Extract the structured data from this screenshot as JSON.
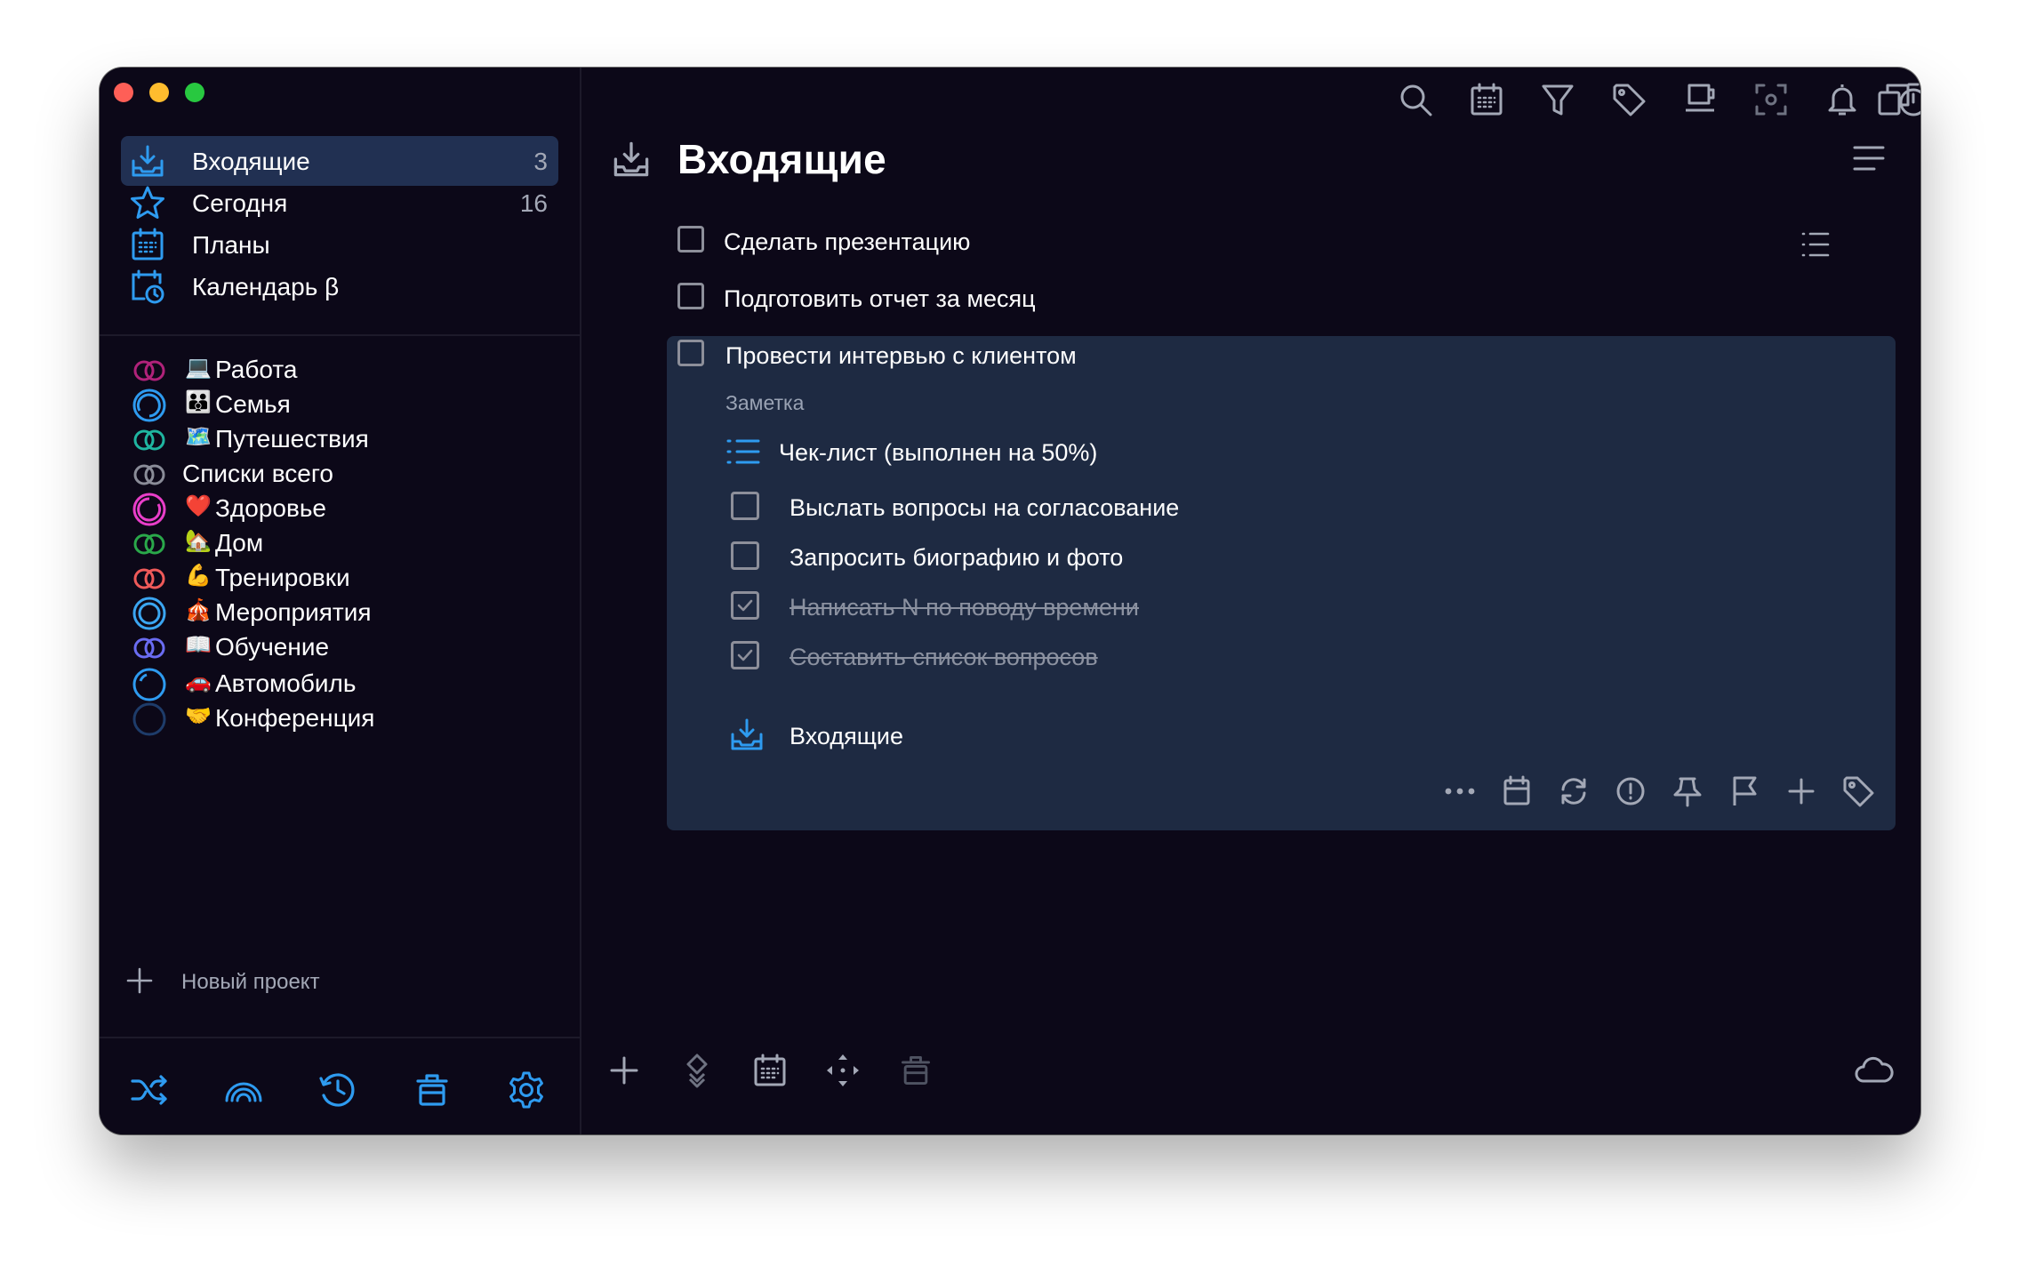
{
  "window": {
    "traffic_lights": [
      "#fe5f57",
      "#febc2e",
      "#28c840"
    ]
  },
  "colors": {
    "accent": "#2e9bf0",
    "sidebar_active": "#213052",
    "expanded_card": "#1e2a42",
    "background": "#0c0818",
    "muted_text": "#a3a8b6"
  },
  "sidebar": {
    "nav": [
      {
        "label": "Входящие",
        "count": "3",
        "icon": "inbox-icon",
        "active": true
      },
      {
        "label": "Сегодня",
        "count": "16",
        "icon": "star-icon"
      },
      {
        "label": "Планы",
        "count": "",
        "icon": "calendar-grid-icon"
      },
      {
        "label": "Календарь β",
        "count": "",
        "icon": "calendar-clock-icon"
      }
    ],
    "projects": [
      {
        "label": "Работа",
        "emoji": "💻",
        "ring": "double-ring",
        "color": "#b0227a"
      },
      {
        "label": "Семья",
        "emoji": "👪",
        "ring": "progress-ring",
        "color": "#2e9bf0"
      },
      {
        "label": "Путешествия",
        "emoji": "🗺️",
        "ring": "double-ring",
        "color": "#1fb5a0"
      },
      {
        "label": "Списки всего",
        "emoji": "",
        "ring": "double-ring",
        "color": "#8a8c98"
      },
      {
        "label": "Здоровье",
        "emoji": "❤️",
        "ring": "progress-ring",
        "color": "#e93ec9"
      },
      {
        "label": "Дом",
        "emoji": "🏡",
        "ring": "double-ring",
        "color": "#2aa84a"
      },
      {
        "label": "Тренировки",
        "emoji": "💪",
        "ring": "double-ring",
        "color": "#ef5a59"
      },
      {
        "label": "Мероприятия",
        "emoji": "🎪",
        "ring": "target-ring",
        "color": "#3ba6f2"
      },
      {
        "label": "Обучение",
        "emoji": "📖",
        "ring": "double-ring",
        "color": "#6a6cf2"
      },
      {
        "label": "Автомобиль",
        "emoji": "🚗",
        "ring": "progress-ring",
        "color": "#2e9bf0"
      },
      {
        "label": "Конференция",
        "emoji": "🤝",
        "ring": "progress-ring",
        "color": "#1e3c6a"
      }
    ],
    "new_project_label": "Новый проект",
    "bottom_icons": [
      "shuffle-icon",
      "rainbow-icon",
      "history-icon",
      "trash-icon",
      "settings-icon"
    ]
  },
  "toolbar": {
    "icons": [
      "search-icon",
      "calendar-icon",
      "filter-icon",
      "tag-icon",
      "coffee-icon",
      "focus-icon",
      "bell-icon",
      "timer-icon",
      "copy-icon"
    ]
  },
  "main": {
    "title": "Входящие",
    "tasks": [
      {
        "label": "Сделать презентацию",
        "checked": false
      },
      {
        "label": "Подготовить отчет за месяц",
        "checked": false
      },
      {
        "label": "Провести интервью с клиентом",
        "checked": false
      }
    ],
    "expanded": {
      "note_placeholder": "Заметка",
      "checklist_label": "Чек-лист (выполнен на 50%)",
      "checklist_progress": 0.5,
      "items": [
        {
          "label": "Выслать вопросы на согласование",
          "done": false
        },
        {
          "label": "Запросить биографию и фото",
          "done": false
        },
        {
          "label": "Написать N по поводу времени",
          "done": true
        },
        {
          "label": "Составить список вопросов",
          "done": true
        }
      ],
      "project_label": "Входящие",
      "tools": [
        "more-icon",
        "calendar-icon",
        "repeat-icon",
        "priority-icon",
        "pin-icon",
        "flag-icon",
        "add-subtask-icon",
        "tag-icon"
      ]
    },
    "bottom_icons": [
      "add-icon",
      "reorder-icon",
      "calendar-icon",
      "move-icon",
      "trash-icon",
      "cloud-icon"
    ]
  }
}
